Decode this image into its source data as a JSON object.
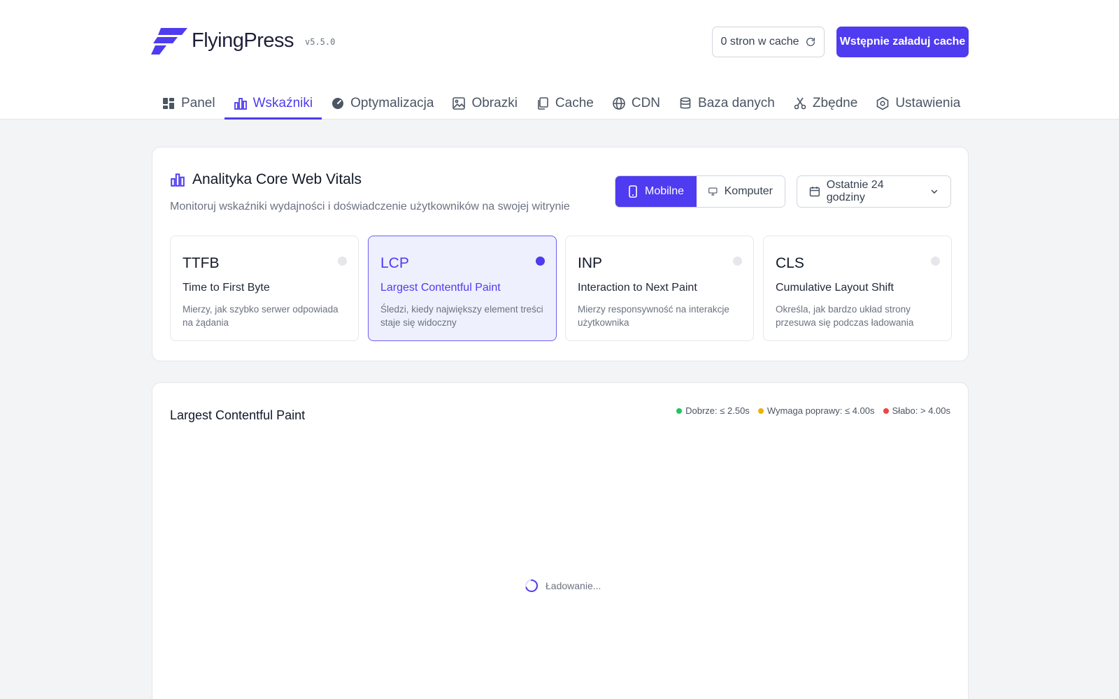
{
  "app": {
    "name": "FlyingPress",
    "version": "v5.5.0"
  },
  "header": {
    "cache_label": "0 stron w cache",
    "preload_label": "Wstępnie załaduj cache"
  },
  "nav": [
    {
      "label": "Panel",
      "icon": "grid-icon"
    },
    {
      "label": "Wskaźniki",
      "icon": "bar-chart-icon",
      "active": true
    },
    {
      "label": "Optymalizacja",
      "icon": "gauge-icon"
    },
    {
      "label": "Obrazki",
      "icon": "image-icon"
    },
    {
      "label": "Cache",
      "icon": "files-icon"
    },
    {
      "label": "CDN",
      "icon": "globe-icon"
    },
    {
      "label": "Baza danych",
      "icon": "database-icon"
    },
    {
      "label": "Zbędne",
      "icon": "scissors-icon"
    },
    {
      "label": "Ustawienia",
      "icon": "settings-hex-icon"
    }
  ],
  "analytics": {
    "title": "Analityka Core Web Vitals",
    "subtitle": "Monitoruj wskaźniki wydajności i doświadczenie użytkowników na swojej witrynie",
    "device_mobile": "Mobilne",
    "device_desktop": "Komputer",
    "range_label": "Ostatnie 24 godziny"
  },
  "metrics": [
    {
      "abbr": "TTFB",
      "name": "Time to First Byte",
      "desc": "Mierzy, jak szybko serwer odpowiada na żądania"
    },
    {
      "abbr": "LCP",
      "name": "Largest Contentful Paint",
      "desc": "Śledzi, kiedy największy element treści staje się widoczny",
      "selected": true
    },
    {
      "abbr": "INP",
      "name": "Interaction to Next Paint",
      "desc": "Mierzy responsywność na interakcje użytkownika"
    },
    {
      "abbr": "CLS",
      "name": "Cumulative Layout Shift",
      "desc": "Określa, jak bardzo układ strony przesuwa się podczas ładowania"
    }
  ],
  "chart_panel": {
    "title": "Largest Contentful Paint",
    "legend": [
      {
        "label": "Dobrze: ≤ 2.50s",
        "color": "#22c55e"
      },
      {
        "label": "Wymaga poprawy: ≤ 4.00s",
        "color": "#eab308"
      },
      {
        "label": "Słabo: > 4.00s",
        "color": "#ef4444"
      }
    ],
    "loading": "Ładowanie..."
  },
  "colors": {
    "accent": "#4f3bf0"
  }
}
